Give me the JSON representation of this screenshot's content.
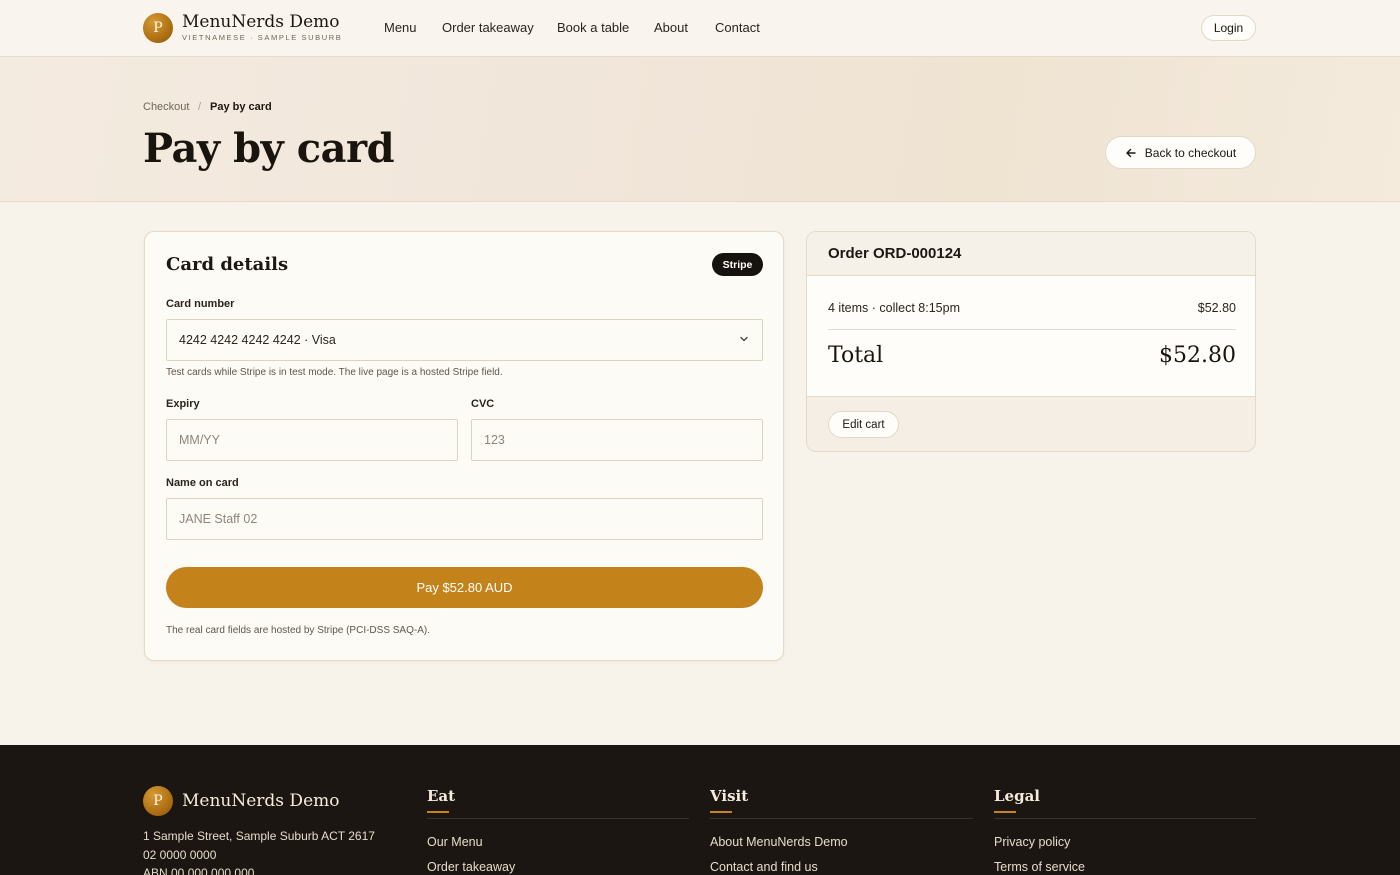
{
  "header": {
    "logo_letter": "P",
    "brand": "MenuNerds Demo",
    "subtitle": "VIETNAMESE · SAMPLE SUBURB",
    "nav": [
      "Menu",
      "Order takeaway",
      "Book a table",
      "About",
      "Contact"
    ],
    "login": "Login"
  },
  "hero": {
    "breadcrumb": [
      "Checkout",
      "/",
      "Pay by card"
    ],
    "title": "Pay by card",
    "back_label": "Back to checkout"
  },
  "card_form": {
    "title": "Card details",
    "badge": "Stripe",
    "card_number_label": "Card number",
    "card_number_value": "4242 4242 4242 4242 · Visa",
    "card_number_help": "Test cards while Stripe is in test mode. The live page is a hosted Stripe field.",
    "expiry_label": "Expiry",
    "expiry_placeholder": "MM/YY",
    "cvc_label": "CVC",
    "cvc_placeholder": "123",
    "name_label": "Name on card",
    "name_placeholder": "JANE Staff 02",
    "pay_label": "Pay $52.80 AUD",
    "footnote": "The real card fields are hosted by Stripe (PCI-DSS SAQ-A)."
  },
  "order": {
    "title": "Order ORD-000124",
    "summary": "4 items · collect 8:15pm",
    "summary_amount": "$52.80",
    "total_label": "Total",
    "total_amount": "$52.80",
    "edit_label": "Edit cart"
  },
  "footer": {
    "brand": "MenuNerds Demo",
    "address": "1 Sample Street, Sample Suburb ACT 2617",
    "phone": "02 0000 0000",
    "abn": "ABN 00 000 000 000",
    "columns": [
      {
        "title": "Eat",
        "links": [
          "Our Menu",
          "Order takeaway"
        ]
      },
      {
        "title": "Visit",
        "links": [
          "About MenuNerds Demo",
          "Contact and find us"
        ]
      },
      {
        "title": "Legal",
        "links": [
          "Privacy policy",
          "Terms of service"
        ]
      }
    ]
  },
  "colors": {
    "accent": "#c4821a",
    "background": "#f8f3ea",
    "footer": "#1b1612"
  }
}
